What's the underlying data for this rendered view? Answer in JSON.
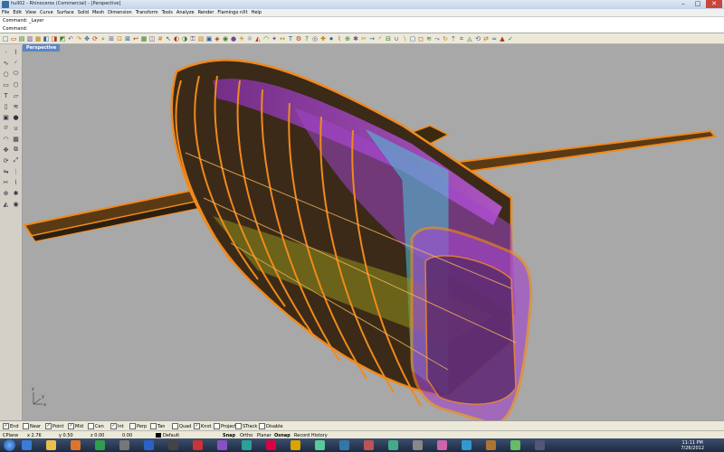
{
  "window": {
    "title": "hull02 - Rhinoceros (Commercial) - [Perspective]",
    "minimize": "–",
    "maximize": "□",
    "close": "✕"
  },
  "menu": [
    "File",
    "Edit",
    "View",
    "Curve",
    "Surface",
    "Solid",
    "Mesh",
    "Dimension",
    "Transform",
    "Tools",
    "Analyze",
    "Render",
    "Flamingo nXt",
    "Help"
  ],
  "command_history": "Command: _Layer",
  "command_prompt": {
    "label": "Command:",
    "value": ""
  },
  "toolbar_icons": [
    "new-icon",
    "open-icon",
    "save-icon",
    "print-icon",
    "import-icon",
    "cut-icon",
    "copy-icon",
    "paste-icon",
    "undo-icon",
    "redo-icon",
    "pan-icon",
    "rotate-view-icon",
    "zoom-icon",
    "zoom-window-icon",
    "zoom-extents-icon",
    "zoom-selected-icon",
    "undo-view-icon",
    "four-views-icon",
    "cplane-icon",
    "grid-icon",
    "select-icon",
    "show-icon",
    "hide-icon",
    "lock-icon",
    "layer-icon",
    "properties-icon",
    "material-icon",
    "render-icon",
    "color-icon",
    "light-icon",
    "bulb-icon",
    "analyze-icon",
    "curvature-icon",
    "flamingo-icon",
    "dimension-icon",
    "text-icon",
    "options-icon",
    "help-icon",
    "osnap-icon",
    "gumball-icon",
    "record-icon",
    "split-icon",
    "join-icon",
    "explode-icon",
    "trim-icon",
    "extend-icon",
    "fillet-icon",
    "offset-icon",
    "boolean-union-icon",
    "boolean-diff-icon",
    "shell-icon",
    "cap-icon",
    "loft-icon",
    "sweep-icon",
    "revolve-icon",
    "extrude-icon",
    "network-icon",
    "patch-icon",
    "rebuild-icon",
    "match-icon",
    "blend-icon",
    "mesh-icon",
    "check-icon"
  ],
  "left_tools": [
    "point-icon",
    "polyline-icon",
    "curve-icon",
    "arc-icon",
    "circle-icon",
    "ellipse-icon",
    "rectangle-icon",
    "polygon-icon",
    "text-icon",
    "surface-icon",
    "extrude-icon",
    "loft-icon",
    "box-icon",
    "sphere-icon",
    "cylinder-icon",
    "boolean-icon",
    "fillet-edge-icon",
    "mesh-icon",
    "move-icon",
    "copy-icon",
    "rotate-icon",
    "scale-icon",
    "mirror-icon",
    "array-icon",
    "trim-icon",
    "split-icon",
    "join-icon",
    "explode-icon",
    "analyze-icon",
    "render-icon"
  ],
  "viewport": {
    "tab_label": "Perspective",
    "axes": {
      "x": "x",
      "y": "y",
      "z": "z"
    }
  },
  "osnaps": [
    {
      "label": "End",
      "checked": true
    },
    {
      "label": "Near",
      "checked": false
    },
    {
      "label": "Point",
      "checked": true
    },
    {
      "label": "Mid",
      "checked": true
    },
    {
      "label": "Cen",
      "checked": false
    },
    {
      "label": "Int",
      "checked": true
    },
    {
      "label": "Perp",
      "checked": false
    },
    {
      "label": "Tan",
      "checked": false
    },
    {
      "label": "Quad",
      "checked": false
    },
    {
      "label": "Knot",
      "checked": true
    },
    {
      "label": "Project",
      "checked": false
    },
    {
      "label": "STrack",
      "checked": false
    },
    {
      "label": "Disable",
      "checked": false
    }
  ],
  "status": {
    "cplane": "CPlane",
    "x": "x 2.76",
    "y": "y 0.50",
    "z": "z 0.00",
    "value": "0.00",
    "layer": "Default",
    "toggles": [
      "Snap",
      "Ortho",
      "Planar",
      "Osnap",
      "Record History"
    ]
  },
  "taskbar": {
    "apps": [
      "ie",
      "explorer",
      "firefox",
      "player",
      "rhino",
      "photoshop",
      "app7",
      "app8",
      "app9",
      "app10",
      "app11",
      "app12",
      "app13",
      "app14",
      "app15",
      "app16",
      "app17",
      "app18",
      "app19",
      "app20",
      "app21",
      "app22"
    ],
    "time": "11:11 PM",
    "date": "7/26/2012"
  },
  "colors": {
    "viewport_bg": "#a8a8a8",
    "hull_outline": "#f08a1c",
    "magenta": "#b34bd4",
    "cyan": "#4fc4d6",
    "olive": "#8a8a1a",
    "tab_blue": "#5b86c6"
  }
}
